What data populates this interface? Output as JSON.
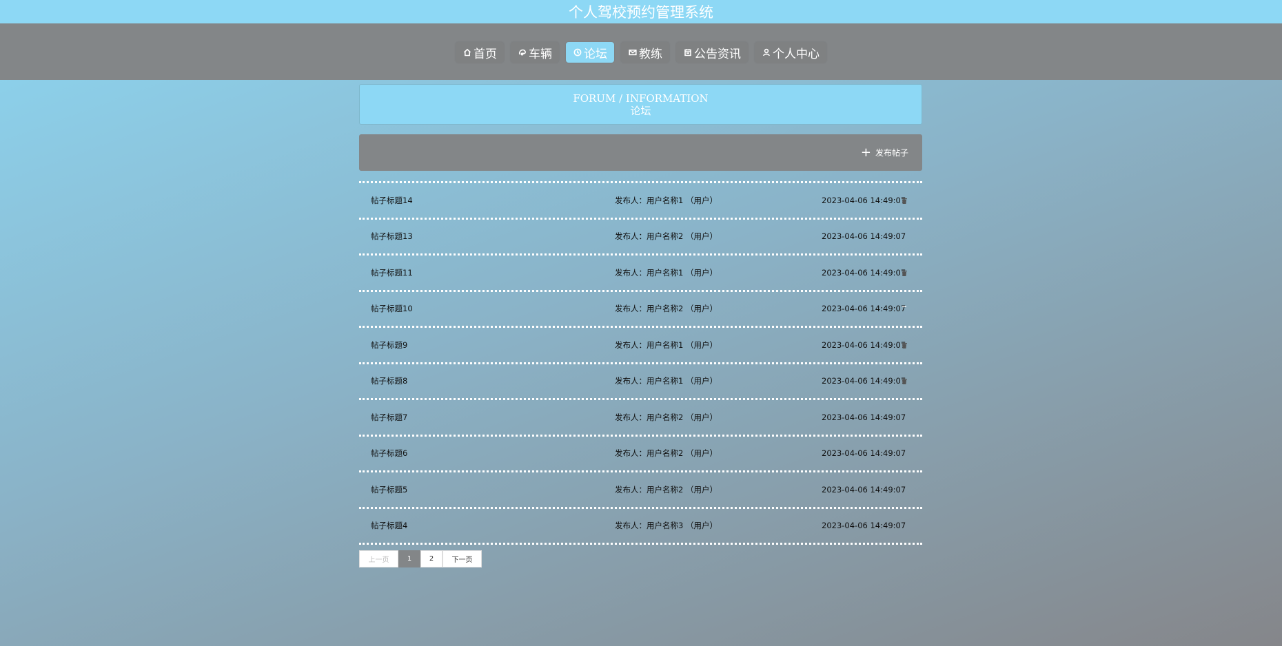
{
  "app": {
    "title": "个人驾校预约管理系统"
  },
  "nav": {
    "items": [
      {
        "label": "首页",
        "icon": "home-icon",
        "active": false
      },
      {
        "label": "车辆",
        "icon": "car-icon",
        "active": false
      },
      {
        "label": "论坛",
        "icon": "clock-icon",
        "active": true
      },
      {
        "label": "教练",
        "icon": "mail-icon",
        "active": false
      },
      {
        "label": "公告资讯",
        "icon": "calendar-icon",
        "active": false
      },
      {
        "label": "个人中心",
        "icon": "user-icon",
        "active": false
      }
    ]
  },
  "page_header": {
    "en": "FORUM / INFORMATION",
    "cn": "论坛"
  },
  "toolbar": {
    "publish_label": "发布帖子"
  },
  "posts": [
    {
      "title": "帖子标题14",
      "author": "发布人：用户名称1 （用户）",
      "time": "2023-04-06 14:49:07",
      "deletable": true
    },
    {
      "title": "帖子标题13",
      "author": "发布人：用户名称2 （用户）",
      "time": "2023-04-06 14:49:07",
      "deletable": false
    },
    {
      "title": "帖子标题11",
      "author": "发布人：用户名称1 （用户）",
      "time": "2023-04-06 14:49:07",
      "deletable": true
    },
    {
      "title": "帖子标题10",
      "author": "发布人：用户名称2 （用户）",
      "time": "2023-04-06 14:49:07",
      "deletable": false
    },
    {
      "title": "帖子标题9",
      "author": "发布人：用户名称1 （用户）",
      "time": "2023-04-06 14:49:07",
      "deletable": true
    },
    {
      "title": "帖子标题8",
      "author": "发布人：用户名称1 （用户）",
      "time": "2023-04-06 14:49:07",
      "deletable": true
    },
    {
      "title": "帖子标题7",
      "author": "发布人：用户名称2 （用户）",
      "time": "2023-04-06 14:49:07",
      "deletable": false
    },
    {
      "title": "帖子标题6",
      "author": "发布人：用户名称2 （用户）",
      "time": "2023-04-06 14:49:07",
      "deletable": false
    },
    {
      "title": "帖子标题5",
      "author": "发布人：用户名称2 （用户）",
      "time": "2023-04-06 14:49:07",
      "deletable": false
    },
    {
      "title": "帖子标题4",
      "author": "发布人：用户名称3 （用户）",
      "time": "2023-04-06 14:49:07",
      "deletable": false
    }
  ],
  "pagination": {
    "prev_label": "上一页",
    "pages": [
      "1",
      "2"
    ],
    "current": "1",
    "next_label": "下一页"
  }
}
